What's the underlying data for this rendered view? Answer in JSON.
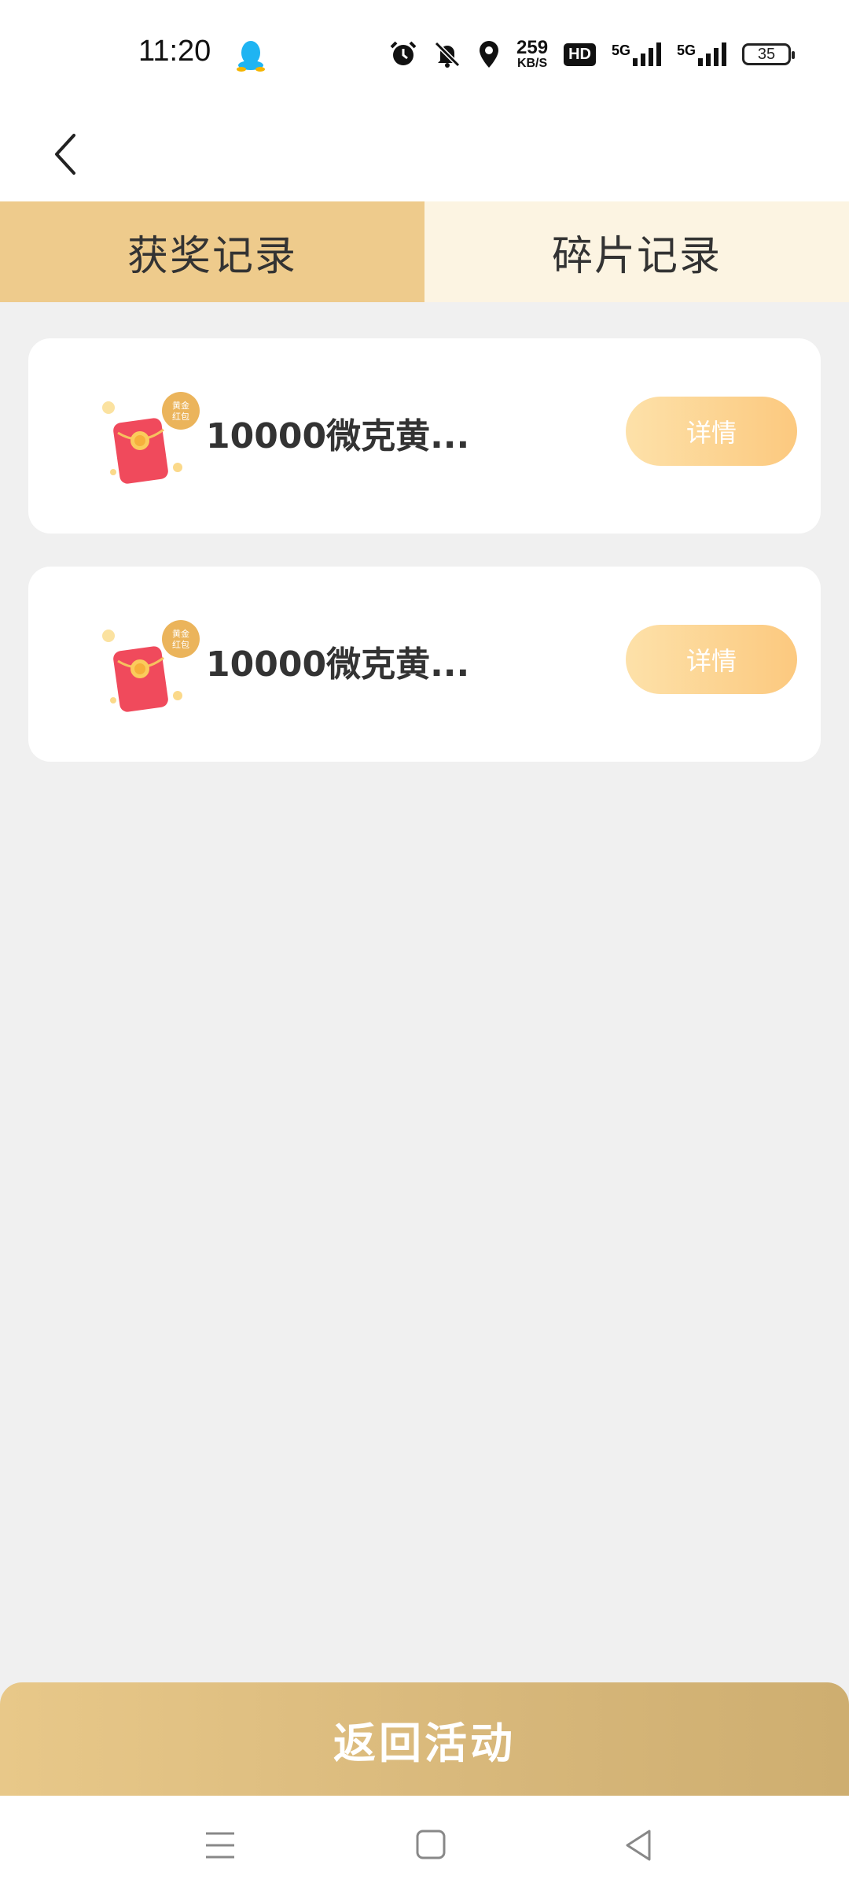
{
  "status_bar": {
    "time": "11:20",
    "speed_value": "259",
    "speed_unit": "KB/S",
    "hd_label": "HD",
    "network_1": "5G",
    "network_2": "5G",
    "battery": "35",
    "icons": [
      "qq-icon",
      "alarm-icon",
      "mute-bell-icon",
      "location-icon",
      "signal-icon",
      "signal-icon"
    ]
  },
  "header": {
    "back_icon": "chevron-left-icon"
  },
  "tabs": [
    {
      "label": "获奖记录",
      "active": true
    },
    {
      "label": "碎片记录",
      "active": false
    }
  ],
  "records": [
    {
      "icon": "red-envelope-icon",
      "badge": "黄金红包",
      "title": "10000微克黄...",
      "action": "详情"
    },
    {
      "icon": "red-envelope-icon",
      "badge": "黄金红包",
      "title": "10000微克黄...",
      "action": "详情"
    }
  ],
  "footer": {
    "return_label": "返回活动"
  },
  "nav_bar": {
    "items": [
      "menu-icon",
      "home-icon",
      "back-triangle-icon"
    ]
  },
  "colors": {
    "tab_active": "#eecb8c",
    "tab_inactive": "#fcf4e2",
    "button_gold": "#fcc97f",
    "return_button": "#d7b77a",
    "background": "#f0f0f0"
  }
}
